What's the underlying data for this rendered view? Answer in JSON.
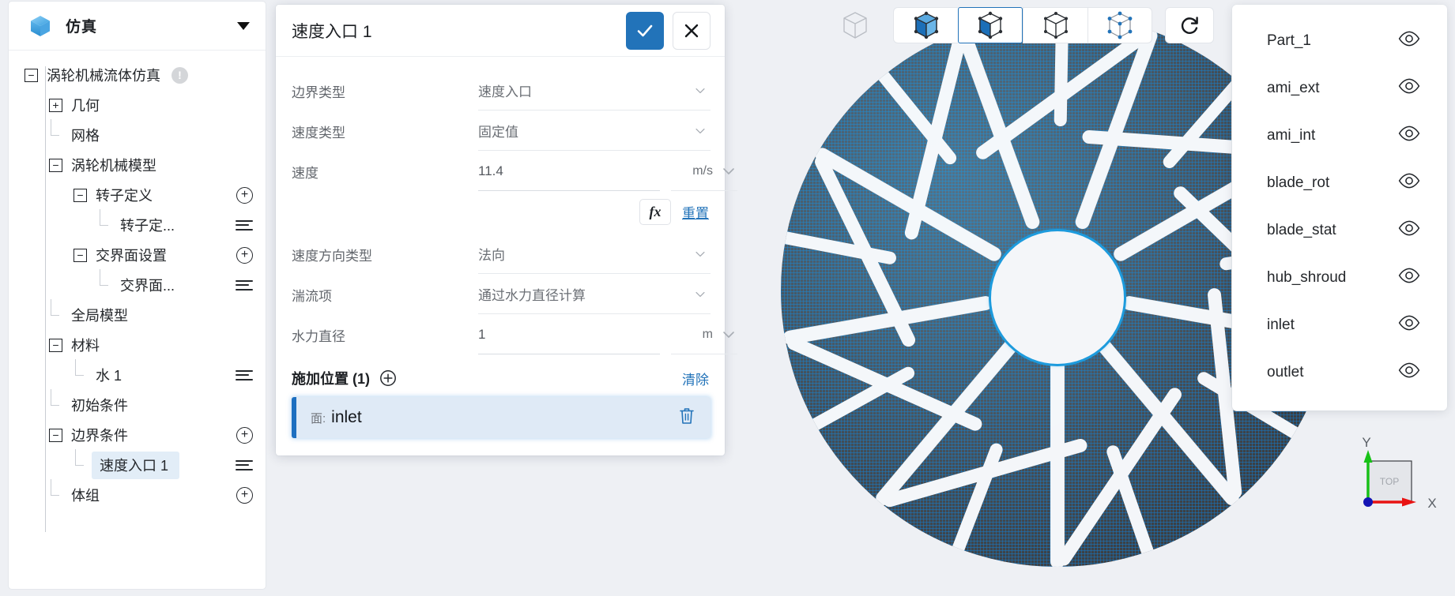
{
  "app": {
    "title": "仿真",
    "logo_icon": "cube-logo-icon",
    "dropdown_icon": "caret-down-icon"
  },
  "sidebar": {
    "tree": [
      {
        "label": "涡轮机械流体仿真",
        "toggle": "minus",
        "depth": 0,
        "badge": "!",
        "selected": false
      },
      {
        "label": "几何",
        "toggle": "plus",
        "depth": 1,
        "selected": false
      },
      {
        "label": "网格",
        "toggle": "elbow",
        "depth": 1,
        "selected": false
      },
      {
        "label": "涡轮机械模型",
        "toggle": "minus",
        "depth": 1,
        "selected": false
      },
      {
        "label": "转子定义",
        "toggle": "minus",
        "depth": 2,
        "action": "plus",
        "selected": false
      },
      {
        "label": "转子定...",
        "toggle": "elbow",
        "depth": 3,
        "action": "menu",
        "selected": false
      },
      {
        "label": "交界面设置",
        "toggle": "minus",
        "depth": 2,
        "action": "plus",
        "selected": false
      },
      {
        "label": "交界面...",
        "toggle": "elbow",
        "depth": 3,
        "action": "menu",
        "selected": false
      },
      {
        "label": "全局模型",
        "toggle": "elbow",
        "depth": 1,
        "selected": false
      },
      {
        "label": "材料",
        "toggle": "minus",
        "depth": 1,
        "selected": false
      },
      {
        "label": "水 1",
        "toggle": "elbow",
        "depth": 2,
        "action": "menu",
        "selected": false
      },
      {
        "label": "初始条件",
        "toggle": "elbow",
        "depth": 1,
        "selected": false
      },
      {
        "label": "边界条件",
        "toggle": "minus",
        "depth": 1,
        "action": "plus",
        "selected": false
      },
      {
        "label": "速度入口 1",
        "toggle": "elbow",
        "depth": 2,
        "action": "menu",
        "selected": true
      },
      {
        "label": "体组",
        "toggle": "elbow",
        "depth": 1,
        "action": "plus",
        "selected": false
      }
    ]
  },
  "dialog": {
    "title": "速度入口 1",
    "confirm_icon": "check-icon",
    "cancel_icon": "close-icon",
    "fields": [
      {
        "label": "边界类型",
        "value": "速度入口",
        "kind": "select"
      },
      {
        "label": "速度类型",
        "value": "固定值",
        "kind": "select"
      },
      {
        "label": "速度",
        "value": "11.4",
        "kind": "input",
        "unit": "m/s"
      },
      {
        "label": "速度方向类型",
        "value": "法向",
        "kind": "select"
      },
      {
        "label": "湍流项",
        "value": "通过水力直径计算",
        "kind": "select"
      },
      {
        "label": "水力直径",
        "value": "1",
        "kind": "input",
        "unit": "m"
      }
    ],
    "fx_label": "fx",
    "reset_label": "重置",
    "location": {
      "title": "施加位置 (1)",
      "add_icon": "plus-circle-icon",
      "clear_label": "清除",
      "items": [
        {
          "kind": "面:",
          "name": "inlet",
          "delete_icon": "trash-icon"
        }
      ]
    }
  },
  "viewport": {
    "toolbar": {
      "cube_icon": "cube-outline-icon",
      "buttons": [
        {
          "name": "shaded-view",
          "icon": "cube-solid-icon",
          "active": false
        },
        {
          "name": "shaded-with-edges-view",
          "icon": "cube-halfsolid-icon",
          "active": true
        },
        {
          "name": "wireframe-view",
          "icon": "cube-wireframe-icon",
          "active": false
        },
        {
          "name": "points-view",
          "icon": "cube-points-icon",
          "active": false
        }
      ],
      "reset_icon": "rotate-reset-icon"
    },
    "triad": {
      "x_label": "X",
      "y_label": "Y",
      "face_label": "TOP",
      "x_color": "#e81313",
      "y_color": "#17c217",
      "z_color": "#1414b4"
    },
    "model": {
      "blade_count": 9,
      "mesh_edge_color": "#1d88d0",
      "surface_color": "#44474b",
      "hub_rim_color": "#1d9bdd"
    }
  },
  "parts_panel": {
    "items": [
      {
        "label": "Part_1",
        "visible_icon": "eye-icon"
      },
      {
        "label": "ami_ext",
        "visible_icon": "eye-icon"
      },
      {
        "label": "ami_int",
        "visible_icon": "eye-icon"
      },
      {
        "label": "blade_rot",
        "visible_icon": "eye-icon"
      },
      {
        "label": "blade_stat",
        "visible_icon": "eye-icon"
      },
      {
        "label": "hub_shroud",
        "visible_icon": "eye-icon"
      },
      {
        "label": "inlet",
        "visible_icon": "eye-icon"
      },
      {
        "label": "outlet",
        "visible_icon": "eye-icon"
      }
    ]
  },
  "colors": {
    "accent": "#2273b9",
    "selection_bg": "#e2edf7",
    "chip_bg": "#dfeaf6",
    "canvas_bg": "#eef0f4"
  }
}
